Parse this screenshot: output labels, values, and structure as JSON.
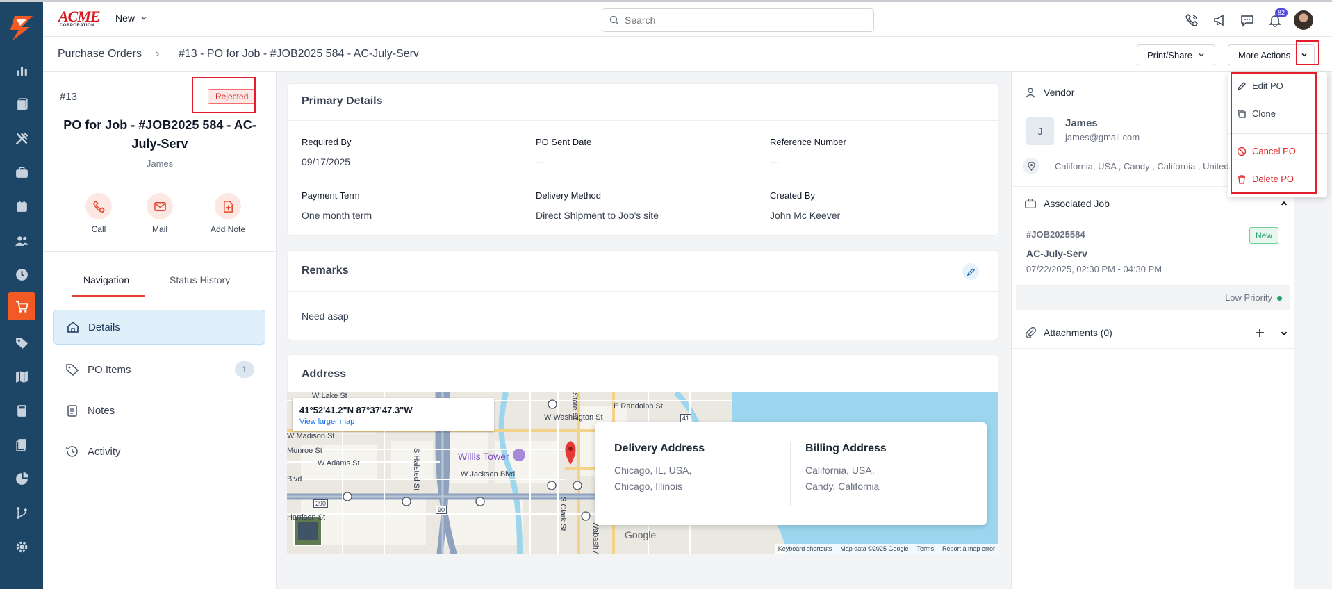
{
  "brand": {
    "name": "ACME",
    "sub": "CORPORATION"
  },
  "topbar": {
    "new_label": "New",
    "search_placeholder": "Search",
    "notification_count": "82"
  },
  "breadcrumb": {
    "root": "Purchase Orders",
    "current": "#13 - PO for Job - #JOB2025 584 - AC-July-Serv"
  },
  "actions": {
    "print_share": "Print/Share",
    "more_actions": "More Actions"
  },
  "dropdown": {
    "edit": "Edit PO",
    "clone": "Clone",
    "cancel": "Cancel PO",
    "delete": "Delete PO"
  },
  "po": {
    "number": "#13",
    "status": "Rejected",
    "title": "PO for Job - #JOB2025 584 - AC-July-Serv",
    "vendor": "James"
  },
  "quick_actions": {
    "call": "Call",
    "mail": "Mail",
    "add_note": "Add Note"
  },
  "tabs": {
    "navigation": "Navigation",
    "status_history": "Status History"
  },
  "nav": {
    "details": "Details",
    "po_items": "PO Items",
    "po_items_count": "1",
    "notes": "Notes",
    "activity": "Activity"
  },
  "primary_details": {
    "title": "Primary Details",
    "required_by_label": "Required By",
    "required_by": "09/17/2025",
    "po_sent_date_label": "PO Sent Date",
    "po_sent_date": "---",
    "reference_number_label": "Reference Number",
    "reference_number": "---",
    "payment_term_label": "Payment Term",
    "payment_term": "One month term",
    "delivery_method_label": "Delivery Method",
    "delivery_method": "Direct Shipment to Job's site",
    "created_by_label": "Created By",
    "created_by": "John Mc Keever"
  },
  "remarks": {
    "title": "Remarks",
    "text": "Need asap"
  },
  "address": {
    "title": "Address",
    "coordinates": "41°52'41.2\"N 87°37'47.3\"W",
    "view_larger_map": "View larger map",
    "delivery_title": "Delivery Address",
    "delivery_line1": "Chicago, IL, USA,",
    "delivery_line2": "Chicago, Illinois",
    "billing_title": "Billing Address",
    "billing_line1": "California, USA,",
    "billing_line2": "Candy, California"
  },
  "map_labels": {
    "lake": "W Lake St",
    "washington": "W Washington St",
    "randolph": "E Randolph St",
    "madison": "W Madison St",
    "monroe": "Monroe St",
    "adams": "W Adams St",
    "jackson": "W Jackson Blvd",
    "blvd": "Blvd",
    "harrison": "Harrison St",
    "willis": "Willis Tower",
    "halsted": "S Halsted St",
    "clark": "S Clark St",
    "state": "State St",
    "wabash": "Wabash Ave",
    "i290": "290",
    "i90": "90",
    "r41": "41",
    "google": "Google",
    "shortcuts": "Keyboard shortcuts",
    "mapdata": "Map data ©2025 Google",
    "terms": "Terms",
    "report": "Report a map error"
  },
  "vendor": {
    "section": "Vendor",
    "initial": "J",
    "name": "James",
    "email": "james@gmail.com",
    "address": "California, USA , Candy , California , United States"
  },
  "job": {
    "section": "Associated Job",
    "id": "#JOB2025584",
    "status": "New",
    "name": "AC-July-Serv",
    "time": "07/22/2025, 02:30 PM - 04:30 PM",
    "priority": "Low Priority"
  },
  "attachments": {
    "label": "Attachments (0)"
  },
  "colors": {
    "accent": "#f15a24",
    "sidebar": "#1d4566",
    "danger": "#dc2626",
    "success": "#22a06b"
  }
}
